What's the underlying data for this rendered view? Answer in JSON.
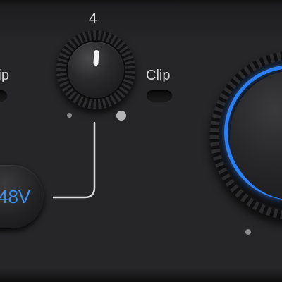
{
  "preamp": {
    "channel_number": "4",
    "gain_knob": {
      "name": "gain"
    }
  },
  "clip_indicators": {
    "left_label": "Clip",
    "right_label": "Clip"
  },
  "phantom_power": {
    "label": "48V"
  },
  "colors": {
    "panel": "#262628",
    "label_text": "#d6d6d8",
    "accent_blue": "#2c7ff2",
    "phantom_text": "#3d8ff0",
    "pointer": "#f2f2f2"
  },
  "icons": [
    "knob-pointer-icon",
    "connector-line-icon"
  ]
}
